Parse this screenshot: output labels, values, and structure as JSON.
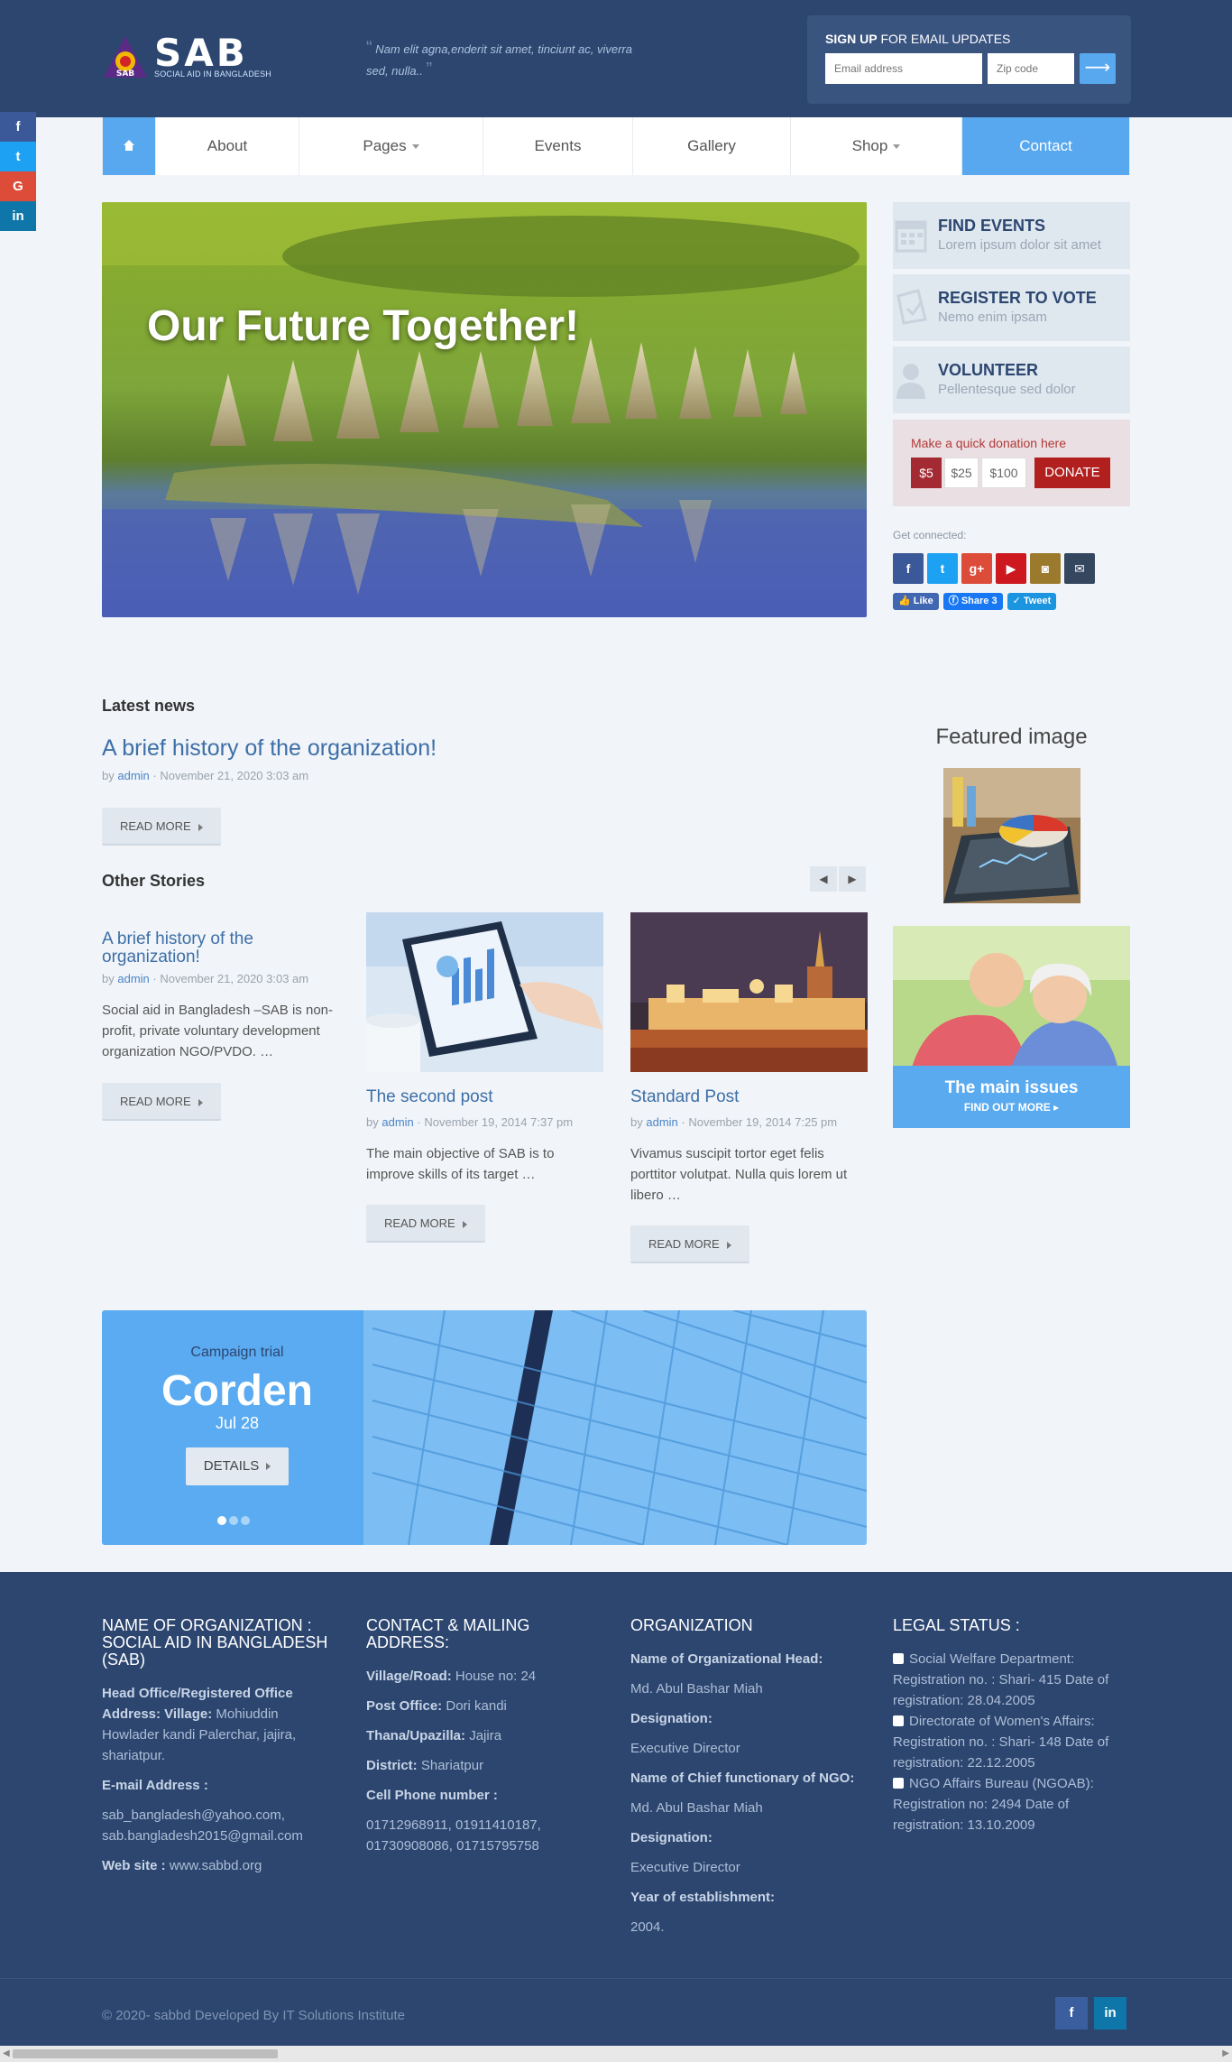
{
  "header": {
    "logo_text": "SAB",
    "logo_sub": "SOCIAL AID IN BANGLADESH",
    "quote": "Nam elit agna,enderit sit amet, tinciunt ac, viverra sed, nulla..",
    "signup_title_bold": "SIGN UP",
    "signup_title_rest": " FOR EMAIL UPDATES",
    "email_placeholder": "Email address",
    "zip_placeholder": "Zip code",
    "submit_icon": "arrow-right-icon"
  },
  "float_social": [
    {
      "icon": "facebook-icon",
      "glyph": "f",
      "color": "#3b5998"
    },
    {
      "icon": "twitter-icon",
      "glyph": "t",
      "color": "#1da1f2"
    },
    {
      "icon": "google-plus-icon",
      "glyph": "G",
      "color": "#dd4b39"
    },
    {
      "icon": "linkedin-icon",
      "glyph": "in",
      "color": "#0e76a8"
    }
  ],
  "nav": {
    "home_icon": "home-icon",
    "items": [
      "About",
      "Pages",
      "Events",
      "Gallery",
      "Shop",
      "Contact"
    ]
  },
  "hero": {
    "title": "Our Future Together!"
  },
  "widgets": [
    {
      "title": "FIND EVENTS",
      "sub": "Lorem ipsum dolor sit amet",
      "icon": "calendar-icon"
    },
    {
      "title": "REGISTER TO VOTE",
      "sub": "Nemo enim ipsam",
      "icon": "ballot-icon"
    },
    {
      "title": "VOLUNTEER",
      "sub": "Pellentesque sed dolor",
      "icon": "user-icon"
    }
  ],
  "donate": {
    "label": "Make a quick donation here",
    "amounts": [
      "$5",
      "$25",
      "$100"
    ],
    "button": "DONATE"
  },
  "connect": {
    "label": "Get connected:",
    "icons": [
      {
        "icon": "facebook-icon",
        "glyph": "f",
        "color": "#3b5998"
      },
      {
        "icon": "twitter-icon",
        "glyph": "t",
        "color": "#1da1f2"
      },
      {
        "icon": "google-plus-icon",
        "glyph": "g+",
        "color": "#dd4b39"
      },
      {
        "icon": "youtube-icon",
        "glyph": "▶",
        "color": "#cc181e"
      },
      {
        "icon": "instagram-icon",
        "glyph": "◙",
        "color": "#9b7a2e"
      },
      {
        "icon": "email-icon",
        "glyph": "✉",
        "color": "#34475f"
      }
    ],
    "like": "Like",
    "share": "Share 3",
    "tweet": "Tweet"
  },
  "latest": {
    "heading": "Latest news",
    "title": "A brief history of the organization!",
    "by": "by",
    "author": "admin",
    "date": "· November 21, 2020 3:03 am",
    "read_more": "READ MORE"
  },
  "featured": {
    "title": "Featured image"
  },
  "other": {
    "heading": "Other Stories",
    "prev_icon": "chevron-left-icon",
    "next_icon": "chevron-right-icon",
    "stories": [
      {
        "title": "A brief history of the organization!",
        "author": "admin",
        "date": "· November 21, 2020 3:03 am",
        "text": "Social aid in Bangladesh –SAB is non-profit, private voluntary development organization   NGO/PVDO. …",
        "read_more": "READ MORE"
      },
      {
        "title": "The second post",
        "author": "admin",
        "date": "· November 19, 2014 7:37 pm",
        "text": "The main objective of SAB is to improve skills of its target …",
        "read_more": "READ MORE"
      },
      {
        "title": "Standard Post",
        "author": "admin",
        "date": "· November 19, 2014 7:25 pm",
        "text": "Vivamus suscipit tortor eget felis porttitor volutpat. Nulla quis lorem ut libero …",
        "read_more": "READ MORE"
      }
    ]
  },
  "issues": {
    "title": "The main issues",
    "link": "FIND OUT MORE"
  },
  "campaign": {
    "label": "Campaign trial",
    "name": "Corden",
    "date": "Jul 28",
    "button": "DETAILS"
  },
  "footer": {
    "col1": {
      "heading": "NAME OF ORGANIZATION : SOCIAL AID IN BANGLADESH (SAB)",
      "office_label": "Head Office/Registered Office Address:  Village:",
      "office_value": " Mohiuddin Howlader kandi Palerchar, jajira, shariatpur.",
      "email_label": "E-mail Address    :",
      "email_value": "sab_bangladesh@yahoo.com, sab.bangladesh2015@gmail.com",
      "web_label": "Web site    :",
      "web_value": "   www.sabbd.org"
    },
    "col2": {
      "heading": "CONTACT & MAILING ADDRESS:",
      "village_label": "Village/Road:",
      "village_value": " House no: 24",
      "post_label": "Post Office:",
      "post_value": " Dori kandi",
      "thana_label": "Thana/Upazilla:",
      "thana_value": " Jajira",
      "district_label": "District:",
      "district_value": " Shariatpur",
      "phone_label": "Cell Phone number :",
      "phone_value": "01712968911, 01911410187, 01730908086, 01715795758"
    },
    "col3": {
      "heading": "ORGANIZATION",
      "head_label": "Name of Organizational Head:",
      "head_value": "Md. Abul Bashar Miah",
      "desig_label": "Designation:",
      "desig_value": "Executive Director",
      "chief_label": "Name of Chief functionary of NGO:",
      "chief_value": "Md. Abul Bashar Miah",
      "desig2_label": "Designation:",
      "desig2_value": "Executive  Director",
      "year_label": "Year of establishment:",
      "year_value": "2004."
    },
    "col4": {
      "heading": "LEGAL STATUS :",
      "items": [
        "Social Welfare Department: Registration no. : Shari- 415 Date of registration: 28.04.2005",
        "Directorate of Women's Affairs: Registration no. : Shari- 148 Date of registration: 22.12.2005",
        "NGO Affairs Bureau (NGOAB): Registration no: 2494 Date of registration: 13.10.2009"
      ]
    },
    "copyright": "© 2020- sabbd Developed By IT Solutions Institute"
  }
}
